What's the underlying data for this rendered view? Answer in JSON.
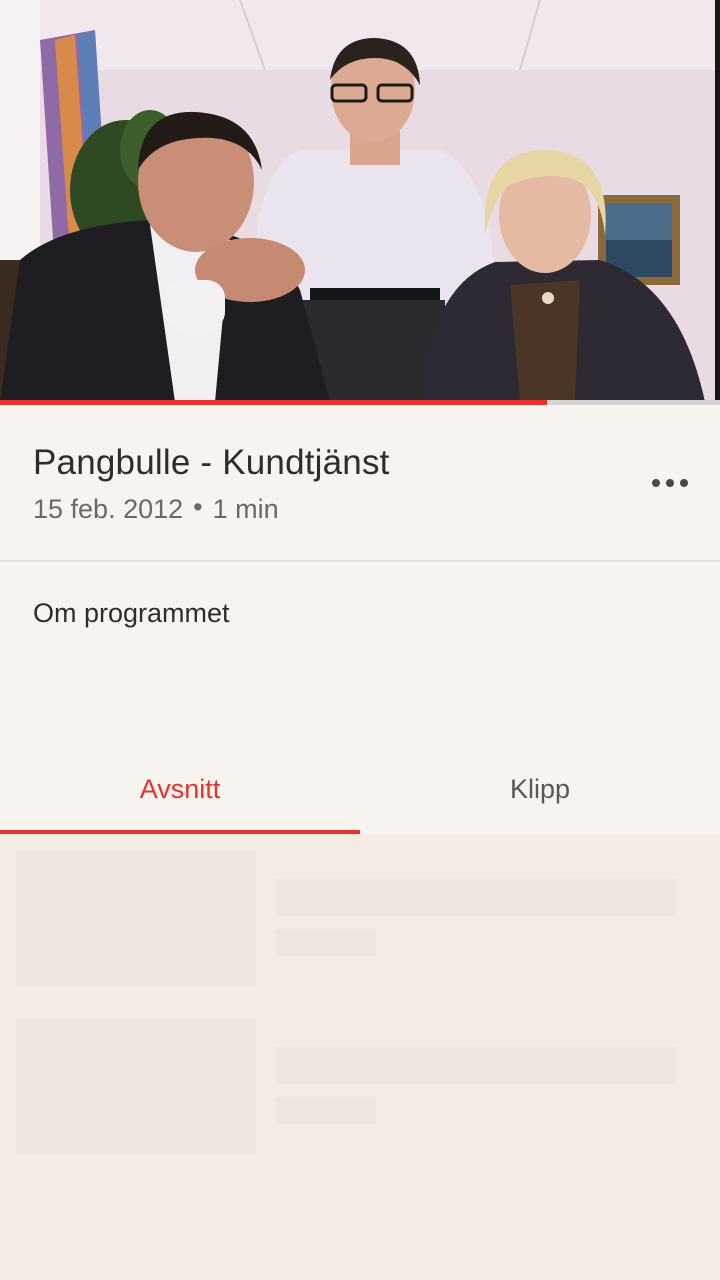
{
  "player": {
    "progress_fraction": 0.76,
    "progress_color": "#e8312a"
  },
  "program": {
    "title": "Pangbulle - Kundtjänst",
    "date": "15 feb. 2012",
    "separator": "•",
    "duration": "1 min",
    "more_icon": "more-horizontal-icon"
  },
  "about": {
    "label": "Om programmet"
  },
  "tabs": [
    {
      "label": "Avsnitt",
      "selected": true
    },
    {
      "label": "Klipp",
      "selected": false
    }
  ],
  "colors": {
    "accent": "#e8312a",
    "background": "#f7f4f0",
    "skeleton": "#ede6e0"
  }
}
